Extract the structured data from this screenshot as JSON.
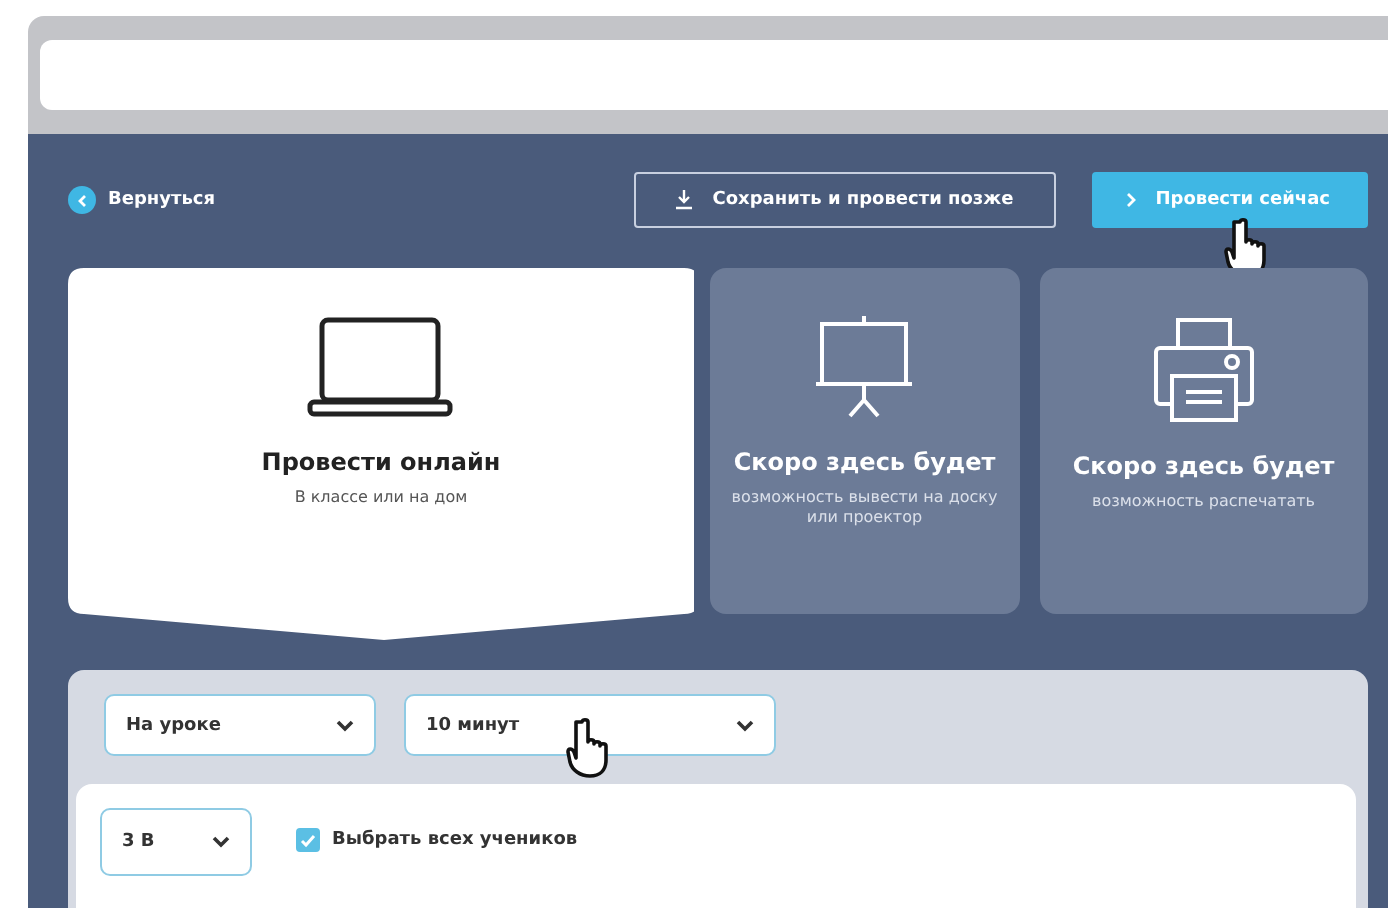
{
  "back": {
    "label": "Вернуться"
  },
  "actions": [
    {
      "label": "Сохранить и провести позже",
      "kind": "outline"
    },
    {
      "label": "Провести сейчас",
      "kind": "primary"
    }
  ],
  "modes": [
    {
      "kind": "laptop",
      "title": "Провести онлайн",
      "subtitle": "В классе или на дом",
      "selected": true
    },
    {
      "kind": "projector",
      "title": "Скоро здесь будет",
      "subtitle": "возможность вывести на доску или проектор",
      "selected": false
    },
    {
      "kind": "printer",
      "title": "Скоро здесь будет",
      "subtitle": "возможность распечатать",
      "selected": false
    }
  ],
  "filters": [
    {
      "value": "На уроке"
    },
    {
      "value": "10 минут"
    }
  ],
  "class_select": {
    "value": "3 В"
  },
  "select_all": {
    "label": "Выбрать всех учеников",
    "checked": true
  }
}
